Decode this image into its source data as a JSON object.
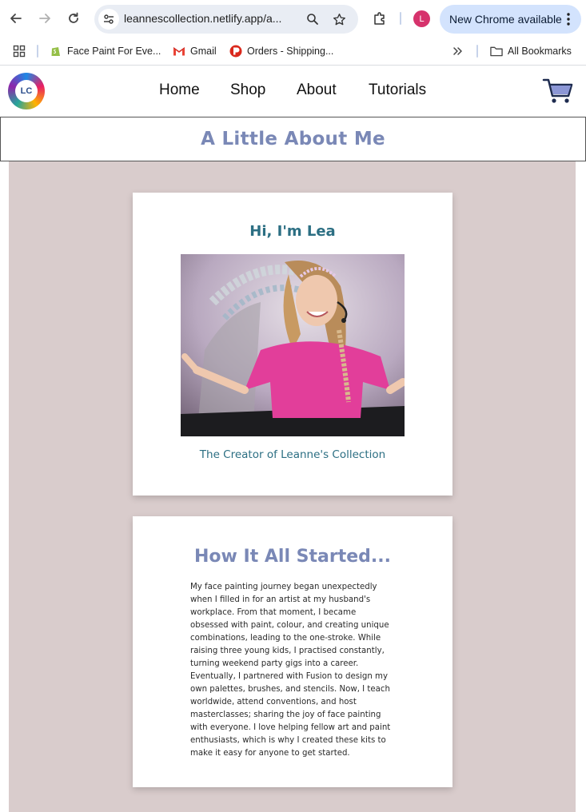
{
  "browser": {
    "url": "leannescollection.netlify.app/a...",
    "profile_initial": "L",
    "update_label": "New Chrome available",
    "icons": [
      "back-arrow-icon",
      "forward-arrow-icon",
      "reload-icon",
      "tune-icon",
      "zoom-icon",
      "star-icon",
      "extensions-icon",
      "kebab-menu-icon"
    ]
  },
  "bookmarks": {
    "items": [
      {
        "label": "Face Paint For Eve...",
        "icon": "shopify-icon"
      },
      {
        "label": "Gmail",
        "icon": "gmail-icon"
      },
      {
        "label": "Orders - Shipping...",
        "icon": "canada-post-icon"
      }
    ],
    "all_bookmarks": "All Bookmarks"
  },
  "site": {
    "logo_text": "LC",
    "nav": [
      "Home",
      "Shop",
      "About",
      "Tutorials"
    ],
    "banner_title": "A Little About Me",
    "intro": {
      "title": "Hi, I'm Lea",
      "caption": "The Creator of Leanne's Collection"
    },
    "story": {
      "title": "How It All Started...",
      "body": "My face painting journey began unexpectedly when I filled in for an artist at my husband's workplace. From that moment, I became obsessed with paint, colour, and creating unique combinations, leading to the one-stroke. While raising three young kids, I practised constantly, turning weekend party gigs into a career. Eventually, I partnered with Fusion to design my own palettes, brushes, and stencils. Now, I teach worldwide, attend conventions, and host masterclasses; sharing the joy of face painting with everyone. I love helping fellow art and paint enthusiasts, which is why I created these kits to make it easy for anyone to get started."
    }
  },
  "colors": {
    "banner_title": "#7a88b6",
    "teal_text": "#2c6f83",
    "main_bg": "#d9cccc",
    "update_pill": "#d3e3fd"
  }
}
